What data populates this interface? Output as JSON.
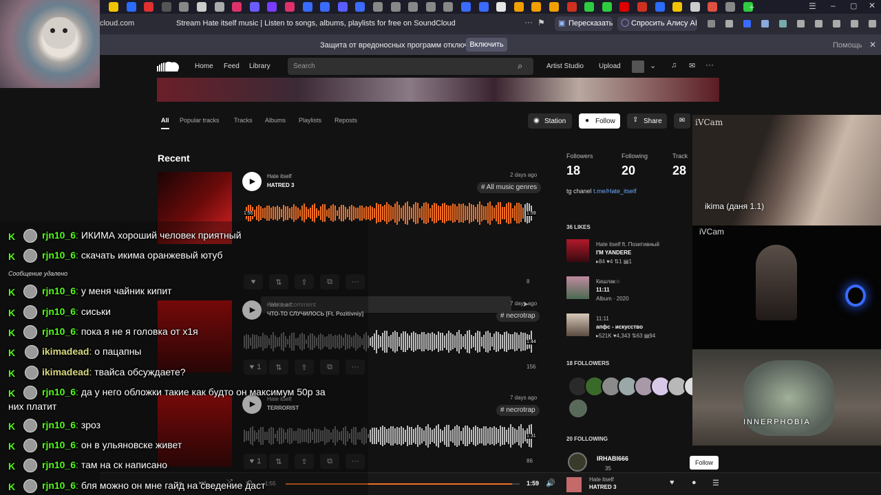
{
  "browser": {
    "address": "cloud.com",
    "page_title": "Stream Hate itself music | Listen to songs, albums, playlists for free on SoundCloud",
    "retell_label": "Пересказать",
    "ask_alice_label": "Спросить Алису AI",
    "malware_notice": "Защита от вредоносных программ отключена",
    "enable_label": "Включить",
    "help_label": "Помощь"
  },
  "nav": {
    "home": "Home",
    "feed": "Feed",
    "library": "Library",
    "search_placeholder": "Search",
    "artist_studio": "Artist Studio",
    "upload": "Upload"
  },
  "profile_tabs": [
    "All",
    "Popular tracks",
    "Tracks",
    "Albums",
    "Playlists",
    "Reposts"
  ],
  "actions": {
    "station": "Station",
    "follow": "Follow",
    "share": "Share"
  },
  "section_recent": "Recent",
  "tracks": [
    {
      "artist": "Hate itself",
      "title": "HATRED 3",
      "date": "2 days ago",
      "tag": "# All music genres",
      "elapsed": "1:55",
      "duration": "1:59",
      "plays": "8",
      "comment_placeholder": "Write a comment",
      "likes": "",
      "accent": "#f26f23"
    },
    {
      "artist": "Hate itself",
      "title": "ЧТО-ТО СЛУЧИЛОСЬ [Ft. Pozitivniy]",
      "date": "7 days ago",
      "tag": "# necrotrap",
      "duration": "1:44",
      "plays": "156",
      "likes": "1"
    },
    {
      "artist": "Hate itself",
      "title": "TERRORIST",
      "date": "7 days ago",
      "tag": "# necrotrap",
      "duration": "1:31",
      "plays": "86",
      "likes": "1"
    }
  ],
  "stats": {
    "followers_label": "Followers",
    "followers": "18",
    "following_label": "Following",
    "following": "20",
    "tracks_label": "Track",
    "tracks": "28"
  },
  "bio": {
    "prefix": "tg chanel",
    "link": "t.me/Hate_itself"
  },
  "likes_section": {
    "title": "36 LIKES",
    "items": [
      {
        "artist": "Hate itself ft. Позитивный",
        "title": "I'M YANDERE",
        "meta": "▸84 ♥4 ⇅1 ▤1"
      },
      {
        "artist": "Кишлак☆",
        "title": "11:11",
        "meta": "Album · 2020"
      },
      {
        "artist": "11:11",
        "title": "апфс - искусство",
        "meta": "▸521K ♥4,343 ⇅63 ▤94"
      }
    ]
  },
  "followers_section": {
    "title": "18 FOLLOWERS"
  },
  "following_section": {
    "title": "20 FOLLOWING",
    "item_name": "IRHABI666",
    "item_meta": "35",
    "follow_label": "Follow"
  },
  "player": {
    "duration": "1:59",
    "artist": "Hate itself",
    "title": "HATRED 3",
    "elapsed": "1:55"
  },
  "overlays": {
    "cam1_label": "iVCam",
    "cam1_caption": "ikima (даня 1.1)",
    "cam2_label": "iVCam",
    "cam3_caption": "INNERPHOBIA"
  },
  "chat": {
    "deleted_notice": "Сообщение удалено",
    "messages": [
      {
        "user": "rjn10_6",
        "text": "ИКИМА хороший человек приятный",
        "color": "#53fc18"
      },
      {
        "user": "rjn10_6",
        "text": "скачать икима оранжевый ютуб",
        "color": "#53fc18"
      },
      {
        "user": "rjn10_6",
        "text": "у меня чайник кипит",
        "color": "#53fc18"
      },
      {
        "user": "rjn10_6",
        "text": "сиськи",
        "color": "#53fc18"
      },
      {
        "user": "rjn10_6",
        "text": "пока я не я головка от х1я",
        "color": "#53fc18"
      },
      {
        "user": "ikimadead",
        "text": "о пацапны",
        "color": "#d9d980"
      },
      {
        "user": "ikimadead",
        "text": "твайса обсуждаете?",
        "color": "#d9d980"
      },
      {
        "user": "rjn10_6",
        "text": "да у него обложки такие как будто он максимум 50р за",
        "color": "#53fc18"
      },
      {
        "user": "rjn10_6",
        "text": "зроз",
        "color": "#53fc18"
      },
      {
        "user": "rjn10_6",
        "text": "он в ульяновске живет",
        "color": "#53fc18"
      },
      {
        "user": "rjn10_6",
        "text": "там на ск написано",
        "color": "#53fc18"
      },
      {
        "user": "rjn10_6",
        "text": "бля можно он мне гайд на сведение даст",
        "color": "#53fc18"
      }
    ],
    "wrap_continuation": "них платит"
  },
  "colors": {
    "accent": "#f26f23",
    "kick_green": "#53fc18",
    "bg": "#121212"
  }
}
